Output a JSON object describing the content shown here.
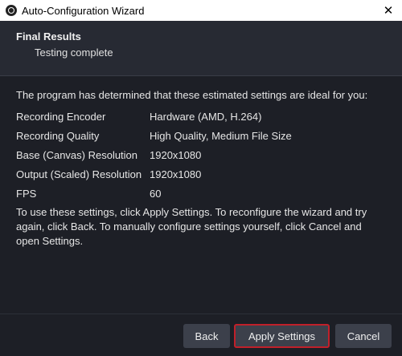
{
  "window": {
    "title": "Auto-Configuration Wizard",
    "close_glyph": "✕"
  },
  "header": {
    "title": "Final Results",
    "subtitle": "Testing complete"
  },
  "content": {
    "intro": "The program has determined that these estimated settings are ideal for you:",
    "settings": [
      {
        "label": "Recording Encoder",
        "value": "Hardware (AMD, H.264)"
      },
      {
        "label": "Recording Quality",
        "value": "High Quality, Medium File Size"
      },
      {
        "label": "Base (Canvas) Resolution",
        "value": "1920x1080"
      },
      {
        "label": "Output (Scaled) Resolution",
        "value": "1920x1080"
      },
      {
        "label": "FPS",
        "value": "60"
      }
    ],
    "instructions": "To use these settings, click Apply Settings. To reconfigure the wizard and try again, click Back. To manually configure settings yourself, click Cancel and open Settings."
  },
  "buttons": {
    "back": "Back",
    "apply": "Apply Settings",
    "cancel": "Cancel"
  },
  "colors": {
    "background": "#1d1f26",
    "header_bg": "#272a33",
    "button_bg": "#3c404b",
    "highlight_border": "#c0202a"
  }
}
